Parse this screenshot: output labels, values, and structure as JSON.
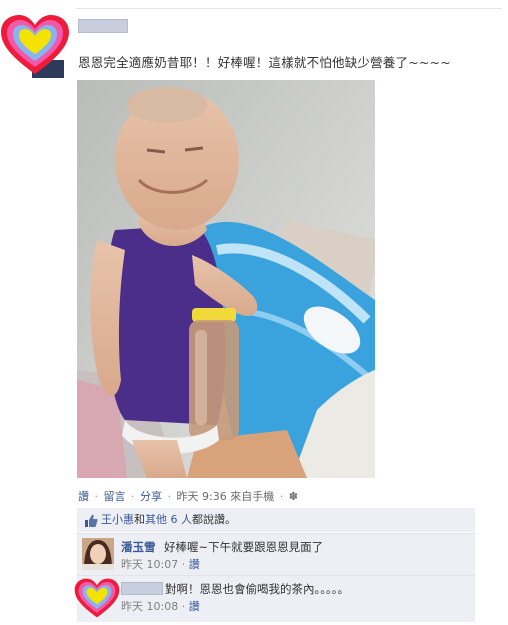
{
  "post": {
    "text": "恩恩完全適應奶昔耶！！好棒喔！這樣就不怕他缺少營養了~~~~",
    "actions": {
      "like": "讚",
      "comment": "留言",
      "share": "分享",
      "time": "昨天 9:36",
      "via": "來自手機",
      "gear_icon": "✽",
      "separator": "·"
    }
  },
  "likes": {
    "names": "王小惠",
    "mid": "和",
    "others": "其他 6 人",
    "suffix": "都說讚。"
  },
  "comments": [
    {
      "author": "潘玉雪",
      "text": "好棒喔~下午就要跟恩恩見面了",
      "time": "昨天 10:07",
      "like": "讚",
      "separator": "·"
    },
    {
      "text": "對啊！恩恩也會偷喝我的茶內。。。。。",
      "time": "昨天 10:08",
      "like": "讚",
      "separator": "·"
    }
  ],
  "colors": {
    "link": "#3b5998",
    "feedback_bg": "#edeff4",
    "heart_outer": "#ee1c3a",
    "heart_inner": "#f4e300"
  }
}
